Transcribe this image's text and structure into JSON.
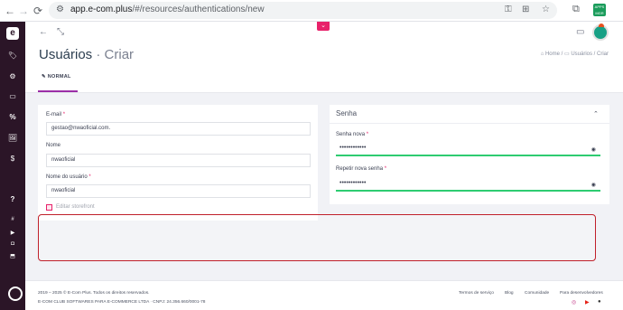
{
  "browser": {
    "back": "←",
    "forward": "→",
    "reload": "⟳",
    "site_info": "⚙",
    "url_host": "app.e-com.plus",
    "url_path": "/#/resources/authentications/new",
    "ext_label": "APPS MGR"
  },
  "sidebar": {
    "logo": "e",
    "items": [
      "🏷",
      "⚙",
      "▭",
      "%",
      "🖼",
      "$",
      "?",
      "#",
      "▶",
      "◘",
      "⬒"
    ]
  },
  "topbar": {
    "back_icon": "←",
    "expand_icon": "⤡",
    "pink_tab_icon": "⌄",
    "message_icon": "▭"
  },
  "header": {
    "title": "Usuários",
    "separator": " · ",
    "subtitle": "Criar",
    "breadcrumb": "⌂ Home / ▭ Usuários / Criar",
    "tab_normal": "NORMAL"
  },
  "form": {
    "email_label": "E-mail",
    "email_value": "gestao@nwaoficial.com.",
    "name_label": "Nome",
    "name_value": "nwaoficial",
    "username_label": "Nome do usuário",
    "username_value": "nwaoficial",
    "storefront_label": "Editar storefront",
    "required_mark": "*"
  },
  "password": {
    "title": "Senha",
    "collapse_icon": "⌃",
    "new_label": "Senha nova",
    "new_value": "••••••••••••",
    "repeat_label": "Repetir nova senha",
    "repeat_value": "••••••••••••",
    "eye_icon": "◉"
  },
  "footer": {
    "copyright": "2019 – 2025 © E-Com Plus. Todos os direitos reservados.",
    "company": "E-COM CLUB SOFTWARES PARA E-COMMERCE LTDA · CNPJ: 24.356.660/0001-78",
    "links": [
      "Termos de serviço",
      "Blog",
      "Comunidade",
      "Para desenvolvedores"
    ]
  },
  "colors": {
    "sidebar": "#2b1527",
    "accent": "#e8216a",
    "tab_underline": "#9b2ea7",
    "password_ok": "#2ecc71",
    "highlight": "#c0202a"
  }
}
